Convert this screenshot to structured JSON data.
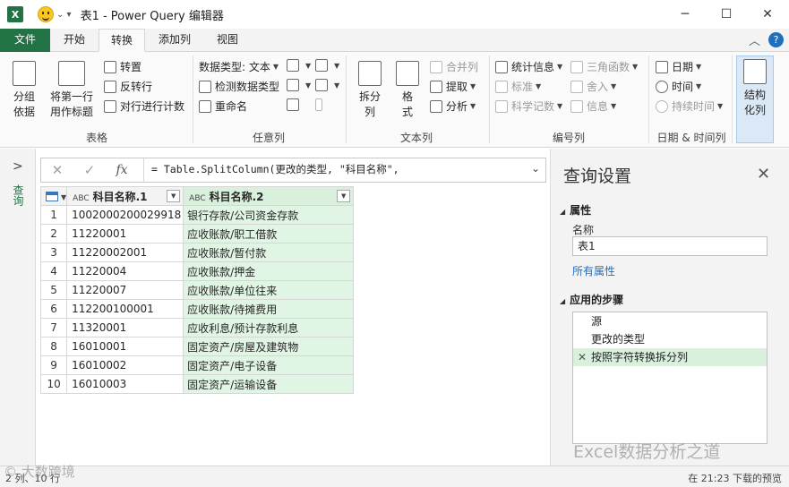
{
  "window": {
    "app_icon": "X",
    "quick_access_caret": "⌄ ▾",
    "title": "表1 - Power Query 编辑器",
    "controls": {
      "minimize": "─",
      "maximize": "☐",
      "close": "✕"
    }
  },
  "tabs": [
    {
      "label": "文件"
    },
    {
      "label": "开始"
    },
    {
      "label": "转换"
    },
    {
      "label": "添加列"
    },
    {
      "label": "视图"
    }
  ],
  "tab_right": {
    "collapse": "︿",
    "help": "?"
  },
  "ribbon": {
    "groups": {
      "table": {
        "label": "表格",
        "group_by": "分组\n依据",
        "use_first_row": "将第一行\n用作标题",
        "transpose": "转置",
        "reverse_rows": "反转行",
        "count_rows": "对行进行计数"
      },
      "any_column": {
        "label": "任意列",
        "data_type": "数据类型: 文本",
        "detect_type": "检测数据类型",
        "rename": "重命名"
      },
      "text_column": {
        "label": "文本列",
        "split_column": "拆分\n列",
        "format": "格\n式",
        "merge_columns": "合并列",
        "extract": "提取",
        "parse": "分析"
      },
      "number_column": {
        "label": "编号列",
        "statistics": "统计信息",
        "standard": "标准",
        "scientific": "科学记数",
        "trigonometry": "三角函数",
        "rounding": "舍入",
        "information": "信息"
      },
      "datetime_column": {
        "label": "日期 & 时间列",
        "date": "日期",
        "time": "时间",
        "duration": "持续时间"
      },
      "structured_column": {
        "label": "结构\n化列"
      }
    }
  },
  "queries_rail": {
    "label": "查询"
  },
  "formula_bar": {
    "cancel": "✕",
    "commit": "✓",
    "fx": "fx",
    "formula": "= Table.SplitColumn(更改的类型, \"科目名称\",",
    "expand": "⌄"
  },
  "grid": {
    "type_badge": "ABC",
    "columns": [
      "科目名称.1",
      "科目名称.2"
    ],
    "rows": [
      [
        "1",
        "1002000200029918",
        "银行存款/公司资金存款"
      ],
      [
        "2",
        "11220001",
        "应收账款/职工借款"
      ],
      [
        "3",
        "11220002001",
        "应收账款/暂付款"
      ],
      [
        "4",
        "11220004",
        "应收账款/押金"
      ],
      [
        "5",
        "11220007",
        "应收账款/单位往来"
      ],
      [
        "6",
        "112200100001",
        "应收账款/待摊费用"
      ],
      [
        "7",
        "11320001",
        "应收利息/预计存款利息"
      ],
      [
        "8",
        "16010001",
        "固定资产/房屋及建筑物"
      ],
      [
        "9",
        "16010002",
        "固定资产/电子设备"
      ],
      [
        "10",
        "16010003",
        "固定资产/运输设备"
      ]
    ]
  },
  "query_settings": {
    "title": "查询设置",
    "close": "✕",
    "properties_header": "属性",
    "name_label": "名称",
    "name_value": "表1",
    "all_properties": "所有属性",
    "steps_header": "应用的步骤",
    "steps": [
      "源",
      "更改的类型",
      "按照字符转换拆分列"
    ]
  },
  "status": {
    "left": "2 列、10 行",
    "right": "在 21:23 下载的预览"
  },
  "watermarks": {
    "right": "Excel数据分析之道",
    "left": "© 大数跨境"
  },
  "colors": {
    "excel_green": "#217346",
    "selected_column": "#e1f5e4",
    "link_blue": "#1f6fbf"
  }
}
